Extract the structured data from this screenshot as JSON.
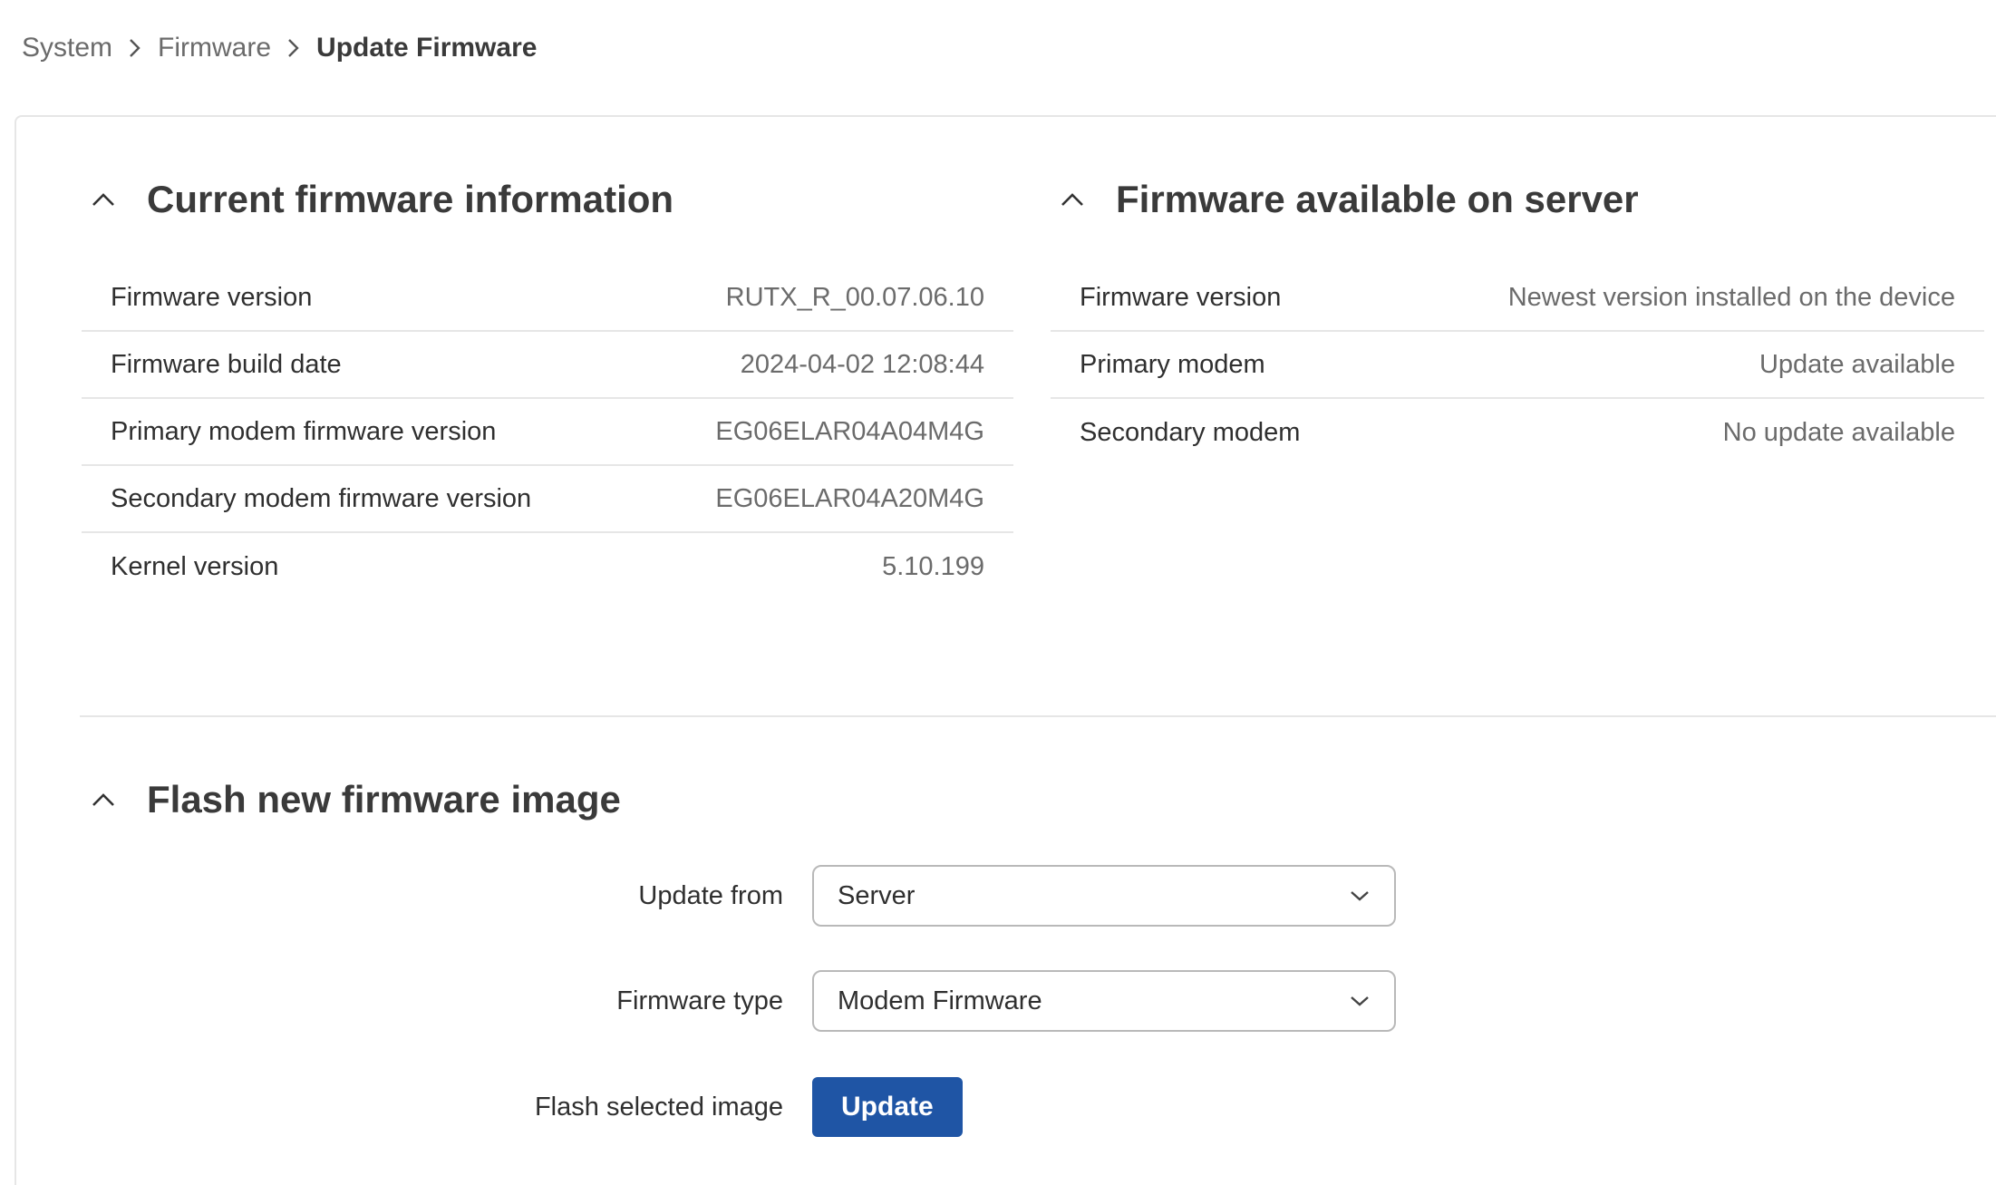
{
  "breadcrumb": {
    "items": [
      "System",
      "Firmware",
      "Update Firmware"
    ]
  },
  "current_firmware": {
    "title": "Current firmware information",
    "rows": [
      {
        "key": "Firmware version",
        "value": "RUTX_R_00.07.06.10"
      },
      {
        "key": "Firmware build date",
        "value": "2024-04-02 12:08:44"
      },
      {
        "key": "Primary modem firmware version",
        "value": "EG06ELAR04A04M4G"
      },
      {
        "key": "Secondary modem firmware version",
        "value": "EG06ELAR04A20M4G"
      },
      {
        "key": "Kernel version",
        "value": "5.10.199"
      }
    ]
  },
  "server_firmware": {
    "title": "Firmware available on server",
    "rows": [
      {
        "key": "Firmware version",
        "value": "Newest version installed on the device"
      },
      {
        "key": "Primary modem",
        "value": "Update available"
      },
      {
        "key": "Secondary modem",
        "value": "No update available"
      }
    ]
  },
  "flash": {
    "title": "Flash new firmware image",
    "update_from_label": "Update from",
    "update_from_value": "Server",
    "firmware_type_label": "Firmware type",
    "firmware_type_value": "Modem Firmware",
    "flash_label": "Flash selected image",
    "update_button": "Update"
  },
  "colors": {
    "accent": "#1f55a5",
    "text": "#333333",
    "muted": "#6b6b6b",
    "border": "#e6e6e6"
  },
  "icons": {
    "breadcrumb_separator": "chevron-right-icon",
    "section_toggle": "chevron-up-icon",
    "select_toggle": "chevron-down-icon"
  }
}
